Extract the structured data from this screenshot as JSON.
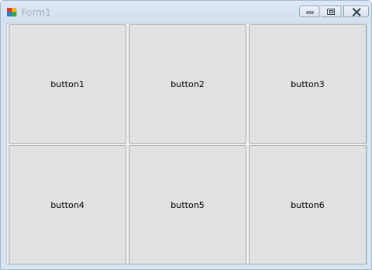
{
  "window": {
    "title": "Form1",
    "icon": "windows-forms-app-icon"
  },
  "titlebar_controls": {
    "minimize_icon": "minimize-icon",
    "restore_icon": "restore-icon",
    "close_icon": "close-icon"
  },
  "buttons": [
    {
      "label": "button1"
    },
    {
      "label": "button2"
    },
    {
      "label": "button3"
    },
    {
      "label": "button4"
    },
    {
      "label": "button5"
    },
    {
      "label": "button6"
    }
  ]
}
